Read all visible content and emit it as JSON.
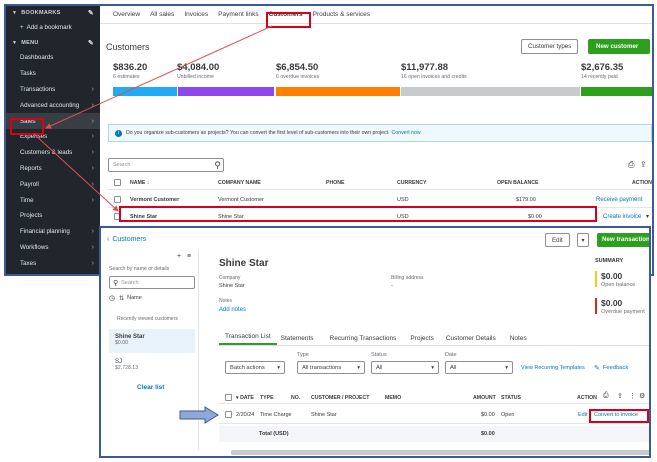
{
  "sidebar": {
    "bookmarks_label": "BOOKMARKS",
    "add_bookmark": "Add a bookmark",
    "menu_label": "MENU",
    "items": [
      {
        "label": "Dashboards",
        "chev": false
      },
      {
        "label": "Tasks",
        "chev": false
      },
      {
        "label": "Transactions",
        "chev": true
      },
      {
        "label": "Advanced accounting",
        "chev": true
      },
      {
        "label": "Sales",
        "chev": true
      },
      {
        "label": "Expenses",
        "chev": true
      },
      {
        "label": "Customers & leads",
        "chev": true
      },
      {
        "label": "Reports",
        "chev": true
      },
      {
        "label": "Payroll",
        "chev": true
      },
      {
        "label": "Time",
        "chev": true
      },
      {
        "label": "Projects",
        "chev": false
      },
      {
        "label": "Financial planning",
        "chev": true
      },
      {
        "label": "Workflows",
        "chev": true
      },
      {
        "label": "Taxes",
        "chev": true
      }
    ]
  },
  "tabs": [
    "Overview",
    "All sales",
    "Invoices",
    "Payment links",
    "Customers",
    "Products & services"
  ],
  "customers": {
    "title": "Customers",
    "customer_types": "Customer types",
    "new_customer": "New customer",
    "metrics": [
      {
        "amount": "$836.20",
        "label": "6 estimates"
      },
      {
        "amount": "$4,084.00",
        "label": "Unbilled income"
      },
      {
        "amount": "$6,854.50",
        "label": "6 overdue invoices"
      },
      {
        "amount": "$11,977.88",
        "label": "16 open invoices and credits"
      },
      {
        "amount": "$2,676.35",
        "label": "14 recently paid"
      }
    ],
    "banner_text": "Do you organize sub-customers as projects? You can convert the first level of sub-customers into their own project.",
    "banner_link": "Convert now",
    "search_placeholder": "Search",
    "columns": [
      "NAME",
      "COMPANY NAME",
      "PHONE",
      "CURRENCY",
      "OPEN BALANCE",
      "ACTION"
    ],
    "rows": [
      {
        "name": "Vermont Customer",
        "company": "Vermont Customer",
        "phone": "",
        "currency": "USD",
        "balance": "$179.00",
        "action": "Receive payment"
      },
      {
        "name": "Shine Star",
        "company": "Shine Star",
        "phone": "",
        "currency": "USD",
        "balance": "$0.00",
        "action": "Create invoice"
      }
    ]
  },
  "detail": {
    "back": "Customers",
    "edit": "Edit",
    "new_transaction": "New transaction",
    "search_label": "Search by name or details",
    "search_placeholder": "Search",
    "sort_label": "Name",
    "recent_label": "Recently viewed customers",
    "list": [
      {
        "name": "Shine Star",
        "amount": "$0.00"
      },
      {
        "name": "SJ",
        "amount": "$2,728.13"
      }
    ],
    "clear_list": "Clear list",
    "name": "Shine Star",
    "company_label": "Company",
    "company_value": "Shine Star",
    "billing_label": "Billing address",
    "billing_value": "-",
    "notes_label": "Notes",
    "add_notes": "Add notes",
    "summary_label": "SUMMARY",
    "open_balance_amt": "$0.00",
    "open_balance_lbl": "Open balance",
    "overdue_amt": "$0.00",
    "overdue_lbl": "Overdue payment",
    "tabs": [
      "Transaction List",
      "Statements",
      "Recurring Transactions",
      "Projects",
      "Customer Details",
      "Notes"
    ],
    "type_label": "Type",
    "status_label": "Status",
    "date_label": "Date",
    "batch_actions": "Batch actions",
    "type_value": "All transactions",
    "status_value": "All",
    "date_value": "All",
    "view_recurring": "View Recurring Templates",
    "feedback": "Feedback",
    "columns": [
      "DATE",
      "TYPE",
      "NO.",
      "CUSTOMER / PROJECT",
      "MEMO",
      "AMOUNT",
      "STATUS",
      "ACTION"
    ],
    "row": {
      "date": "2/20/24",
      "type": "Time Charge",
      "no": "",
      "customer": "Shine Star",
      "memo": "",
      "amount": "$0.00",
      "status": "Open",
      "edit": "Edit",
      "convert": "Convert to invoice"
    },
    "total_label": "Total (USD)",
    "total_value": "$0.00"
  },
  "colors": {
    "sidebar_bg": "#21262c",
    "accent_green": "#2ca01c",
    "link_blue": "#0077c5",
    "highlight_red": "#d9001b",
    "bar_blue": "#21abf6",
    "bar_purple": "#8d47ec",
    "bar_orange": "#ff8000",
    "bar_grey": "#c9cacc",
    "bar_green": "#2ca01c"
  }
}
